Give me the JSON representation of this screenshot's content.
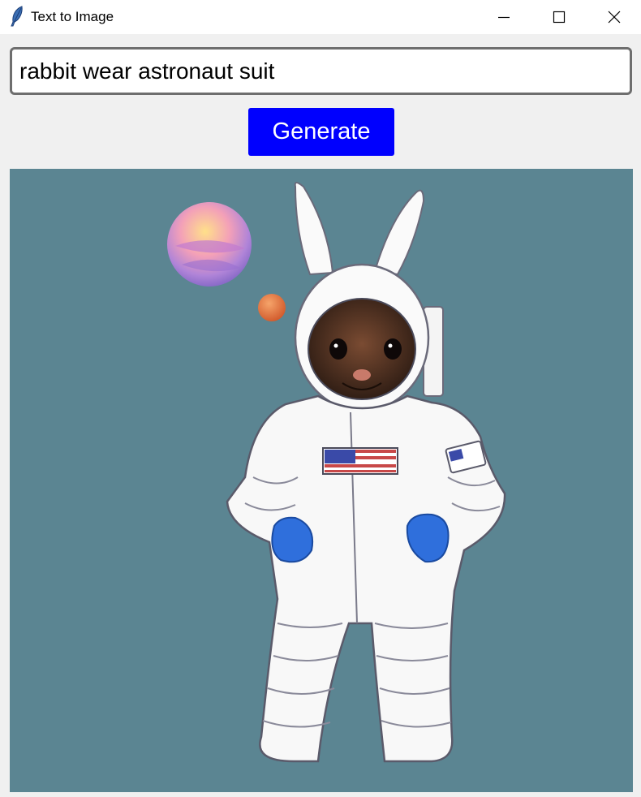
{
  "window": {
    "title": "Text to Image",
    "icon": "feather-icon",
    "controls": [
      "minimize-icon",
      "maximize-icon",
      "close-icon"
    ]
  },
  "prompt": {
    "value": "rabbit wear astronaut suit"
  },
  "generate": {
    "label": "Generate"
  },
  "result": {
    "icon": "generated-image",
    "content": "rabbit in white astronaut suit with two small planets on teal background"
  },
  "colors": {
    "button_bg": "#0000fe",
    "button_text": "#ffffff",
    "window_bg": "#f0f0f0",
    "canvas_bg": "#5b8592",
    "suit": "#f8f8f8",
    "gloves": "#2f6fdc"
  }
}
